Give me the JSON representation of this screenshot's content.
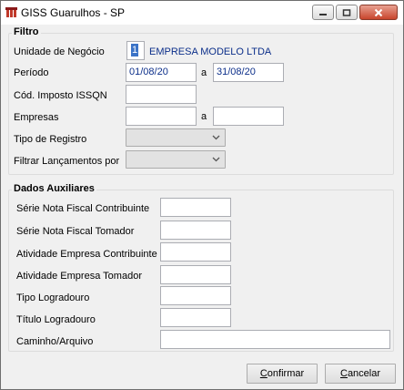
{
  "window": {
    "title": "GISS Guarulhos - SP",
    "icons": {
      "app": "giss-app-icon",
      "minimize": "minimize-icon",
      "maximize": "maximize-icon",
      "close": "close-icon"
    }
  },
  "filtro": {
    "title": "Filtro",
    "unidade_label": "Unidade de Negócio",
    "unidade_code": "1",
    "unidade_name": "EMPRESA MODELO LTDA",
    "periodo_label": "Período",
    "periodo_start": "01/08/20",
    "periodo_sep": "a",
    "periodo_end": "31/08/20",
    "cod_imposto_label": "Cód. Imposto ISSQN",
    "cod_imposto_value": "",
    "empresas_label": "Empresas",
    "empresas_start": "",
    "empresas_sep": "a",
    "empresas_end": "",
    "tipo_registro_label": "Tipo de Registro",
    "tipo_registro_value": "",
    "filtrar_label": "Filtrar Lançamentos por",
    "filtrar_value": ""
  },
  "aux": {
    "title": "Dados Auxiliares",
    "fields": [
      {
        "label": "Série Nota Fiscal Contribuinte",
        "value": ""
      },
      {
        "label": "Série Nota Fiscal Tomador",
        "value": ""
      },
      {
        "label": "Atividade Empresa Contribuinte",
        "value": ""
      },
      {
        "label": "Atividade Empresa Tomador",
        "value": ""
      },
      {
        "label": "Tipo Logradouro",
        "value": ""
      },
      {
        "label": "Título Logradouro",
        "value": ""
      },
      {
        "label": "Caminho/Arquivo",
        "value": ""
      }
    ]
  },
  "buttons": {
    "confirm_prefix": "",
    "confirm_u": "C",
    "confirm_rest": "onfirmar",
    "cancel_prefix": "",
    "cancel_u": "C",
    "cancel_rest": "ancelar"
  }
}
